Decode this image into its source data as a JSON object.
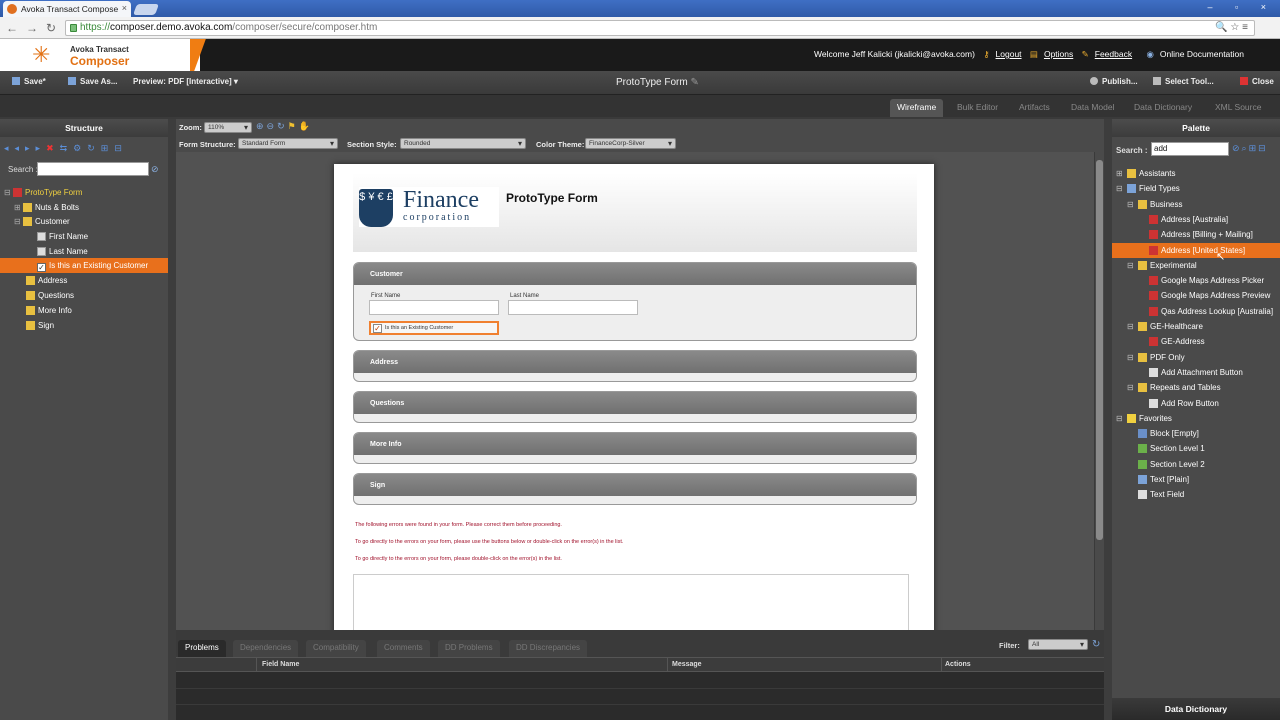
{
  "browser": {
    "tab_title": "Avoka Transact Compose",
    "tab_close": "×",
    "window_controls": "– ▫ ×",
    "url_scheme": "https://",
    "url_host": "composer.demo.avoka.com",
    "url_path": "/composer/secure/composer.htm",
    "right_icons": "🔍 ☆ ≡"
  },
  "header": {
    "logo_line1": "Avoka Transact",
    "logo_line2": "Composer",
    "welcome": "Welcome Jeff Kalicki (jkalicki@avoka.com)",
    "logout": "Logout",
    "options": "Options",
    "feedback": "Feedback",
    "docs": "Online Documentation"
  },
  "toolbar": {
    "save": "Save*",
    "save_as": "Save As...",
    "preview": "Preview: PDF [Interactive]",
    "form_title": "ProtoType Form",
    "publish": "Publish...",
    "select_tool": "Select Tool...",
    "close": "Close"
  },
  "view_tabs": [
    "Wireframe",
    "Bulk Editor",
    "Artifacts",
    "Data Model",
    "Data Dictionary",
    "XML Source"
  ],
  "structure": {
    "title": "Structure",
    "search_label": "Search :",
    "items": [
      {
        "label": "ProtoType Form",
        "tog": "⊟"
      },
      {
        "label": "Nuts & Bolts",
        "tog": "⊞"
      },
      {
        "label": "Customer",
        "tog": "⊟"
      },
      {
        "label": "First Name",
        "tog": ""
      },
      {
        "label": "Last Name",
        "tog": ""
      },
      {
        "label": "Is this an Existing Customer",
        "tog": ""
      },
      {
        "label": "Address",
        "tog": ""
      },
      {
        "label": "Questions",
        "tog": ""
      },
      {
        "label": "More Info",
        "tog": ""
      },
      {
        "label": "Sign",
        "tog": ""
      }
    ]
  },
  "canvas": {
    "zoom_label": "Zoom:",
    "zoom_value": "110%",
    "form_structure_label": "Form Structure:",
    "form_structure_value": "Standard Form",
    "section_style_label": "Section Style:",
    "section_style_value": "Rounded",
    "color_theme_label": "Color Theme:",
    "color_theme_value": "FinanceCorp-Silver"
  },
  "form": {
    "logo_symbols": "$ ¥ € £",
    "logo_line1": "Finance",
    "logo_line2": "corporation",
    "title": "ProtoType Form",
    "sections": [
      "Customer",
      "Address",
      "Questions",
      "More Info",
      "Sign"
    ],
    "first_name_label": "First Name",
    "last_name_label": "Last Name",
    "checkbox_label": "Is this an Existing Customer",
    "checkbox_mark": "✓",
    "errors": [
      "The following errors were found in your form. Please correct them before proceeding.",
      "To go directly to the errors on your form, please use the buttons below or double-click on the error(s) in the list.",
      "To go directly to the errors on your form, please double-click on the error(s) in the list."
    ]
  },
  "problems": {
    "tabs": [
      "Problems",
      "Dependencies",
      "Compatibility",
      "Comments",
      "DD Problems",
      "DD Discrepancies"
    ],
    "filter_label": "Filter:",
    "filter_value": "All",
    "columns": [
      "Field Name",
      "Message",
      "Actions"
    ]
  },
  "palette": {
    "title": "Palette",
    "search_label": "Search :",
    "search_value": "add",
    "items": [
      {
        "label": "Assistants",
        "tog": "⊞",
        "indent": 0
      },
      {
        "label": "Field Types",
        "tog": "⊟",
        "indent": 0
      },
      {
        "label": "Business",
        "tog": "⊟",
        "indent": 1
      },
      {
        "label": "Address [Australia]",
        "tog": "",
        "indent": 2
      },
      {
        "label": "Address [Billing + Mailing]",
        "tog": "",
        "indent": 2
      },
      {
        "label": "Address [United States]",
        "tog": "",
        "indent": 2
      },
      {
        "label": "Experimental",
        "tog": "⊟",
        "indent": 1
      },
      {
        "label": "Google Maps Address Picker",
        "tog": "",
        "indent": 2
      },
      {
        "label": "Google Maps Address Preview",
        "tog": "",
        "indent": 2
      },
      {
        "label": "Qas Address Lookup [Australia]",
        "tog": "",
        "indent": 2
      },
      {
        "label": "GE-Healthcare",
        "tog": "⊟",
        "indent": 1
      },
      {
        "label": "GE-Address",
        "tog": "",
        "indent": 2
      },
      {
        "label": "PDF Only",
        "tog": "⊟",
        "indent": 1
      },
      {
        "label": "Add Attachment Button",
        "tog": "",
        "indent": 2
      },
      {
        "label": "Repeats and Tables",
        "tog": "⊟",
        "indent": 1
      },
      {
        "label": "Add Row Button",
        "tog": "",
        "indent": 2
      },
      {
        "label": "Favorites",
        "tog": "⊟",
        "indent": 0
      },
      {
        "label": "Block [Empty]",
        "tog": "",
        "indent": 1
      },
      {
        "label": "Section Level 1",
        "tog": "",
        "indent": 1
      },
      {
        "label": "Section Level 2",
        "tog": "",
        "indent": 1
      },
      {
        "label": "Text [Plain]",
        "tog": "",
        "indent": 1
      },
      {
        "label": "Text Field",
        "tog": "",
        "indent": 1
      }
    ],
    "footer": "Data Dictionary"
  }
}
